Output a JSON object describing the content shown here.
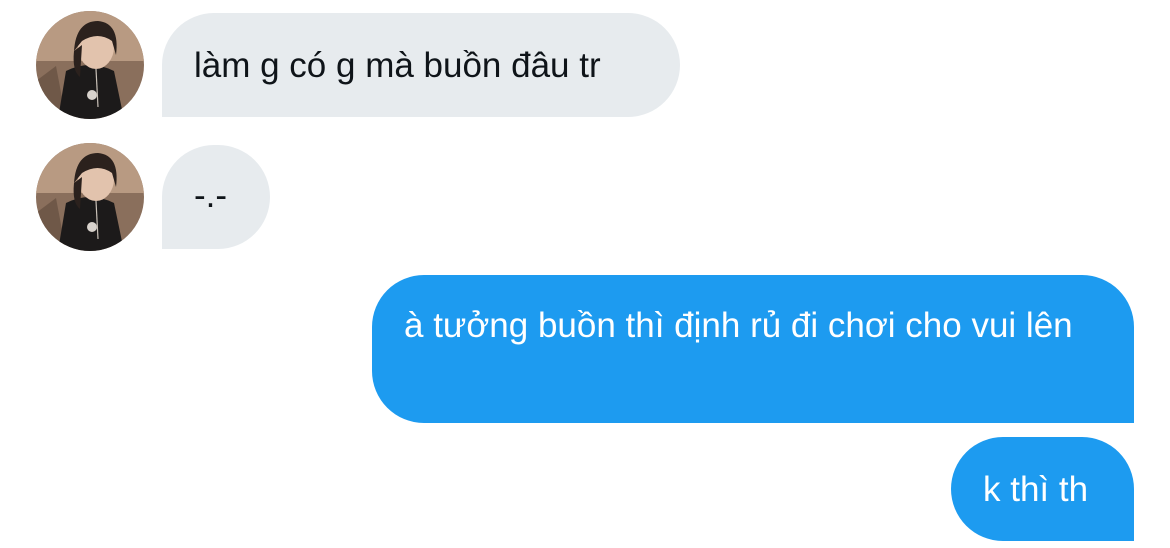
{
  "conversation": {
    "messages": [
      {
        "sender": "other",
        "text": "làm g có g mà buồn đâu tr",
        "avatar_icon": "user-avatar-photo"
      },
      {
        "sender": "other",
        "text": "-.-",
        "avatar_icon": "user-avatar-photo"
      },
      {
        "sender": "me",
        "text": "à tưởng buồn thì định rủ đi chơi cho vui lên"
      },
      {
        "sender": "me",
        "text": "k thì th"
      }
    ]
  },
  "colors": {
    "incoming_bubble": "#e7ebee",
    "outgoing_bubble": "#1d9bf0",
    "incoming_text": "#0f1419",
    "outgoing_text": "#ffffff"
  }
}
